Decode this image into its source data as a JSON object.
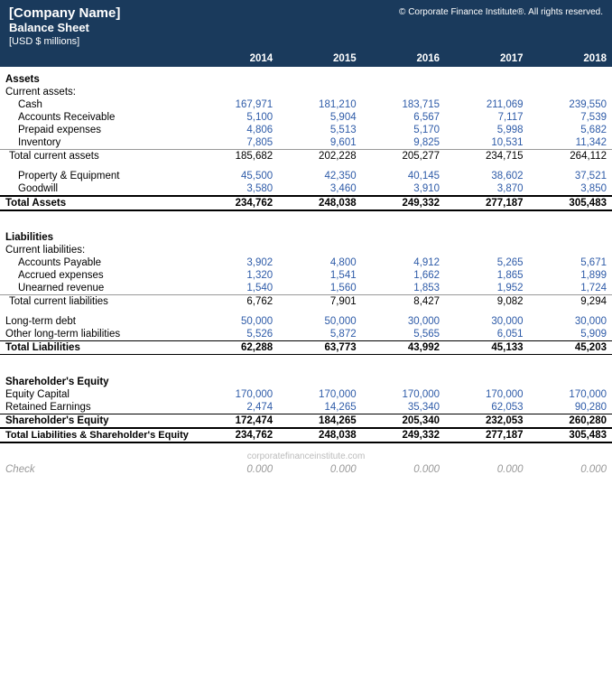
{
  "header": {
    "company_name": "[Company Name]",
    "sheet_title": "Balance Sheet",
    "currency": "[USD $ millions]",
    "copyright": "© Corporate Finance Institute®. All rights reserved."
  },
  "years": [
    "",
    "2014",
    "2015",
    "2016",
    "2017",
    "2018"
  ],
  "sections": {
    "assets_header": "Assets",
    "current_assets_header": "Current assets:",
    "liabilities_header": "Liabilities",
    "current_liabilities_header": "Current liabilities:",
    "shareholder_equity_header": "Shareholder's Equity"
  },
  "rows": {
    "cash": {
      "label": "Cash",
      "values": [
        "167,971",
        "181,210",
        "183,715",
        "211,069",
        "239,550"
      ]
    },
    "accounts_receivable": {
      "label": "Accounts Receivable",
      "values": [
        "5,100",
        "5,904",
        "6,567",
        "7,117",
        "7,539"
      ]
    },
    "prepaid_expenses": {
      "label": "Prepaid expenses",
      "values": [
        "4,806",
        "5,513",
        "5,170",
        "5,998",
        "5,682"
      ]
    },
    "inventory": {
      "label": "Inventory",
      "values": [
        "7,805",
        "9,601",
        "9,825",
        "10,531",
        "11,342"
      ]
    },
    "total_current_assets": {
      "label": "Total current assets",
      "values": [
        "185,682",
        "202,228",
        "205,277",
        "234,715",
        "264,112"
      ]
    },
    "property_equipment": {
      "label": "Property & Equipment",
      "values": [
        "45,500",
        "42,350",
        "40,145",
        "38,602",
        "37,521"
      ]
    },
    "goodwill": {
      "label": "Goodwill",
      "values": [
        "3,580",
        "3,460",
        "3,910",
        "3,870",
        "3,850"
      ]
    },
    "total_assets": {
      "label": "Total Assets",
      "values": [
        "234,762",
        "248,038",
        "249,332",
        "277,187",
        "305,483"
      ]
    },
    "accounts_payable": {
      "label": "Accounts Payable",
      "values": [
        "3,902",
        "4,800",
        "4,912",
        "5,265",
        "5,671"
      ]
    },
    "accrued_expenses": {
      "label": "Accrued expenses",
      "values": [
        "1,320",
        "1,541",
        "1,662",
        "1,865",
        "1,899"
      ]
    },
    "unearned_revenue": {
      "label": "Unearned revenue",
      "values": [
        "1,540",
        "1,560",
        "1,853",
        "1,952",
        "1,724"
      ]
    },
    "total_current_liabilities": {
      "label": "Total current liabilities",
      "values": [
        "6,762",
        "7,901",
        "8,427",
        "9,082",
        "9,294"
      ]
    },
    "long_term_debt": {
      "label": "Long-term debt",
      "values": [
        "50,000",
        "50,000",
        "30,000",
        "30,000",
        "30,000"
      ]
    },
    "other_long_term": {
      "label": "Other long-term liabilities",
      "values": [
        "5,526",
        "5,872",
        "5,565",
        "6,051",
        "5,909"
      ]
    },
    "total_liabilities": {
      "label": "Total Liabilities",
      "values": [
        "62,288",
        "63,773",
        "43,992",
        "45,133",
        "45,203"
      ]
    },
    "equity_capital": {
      "label": "Equity Capital",
      "values": [
        "170,000",
        "170,000",
        "170,000",
        "170,000",
        "170,000"
      ]
    },
    "retained_earnings": {
      "label": "Retained Earnings",
      "values": [
        "2,474",
        "14,265",
        "35,340",
        "62,053",
        "90,280"
      ]
    },
    "shareholder_equity": {
      "label": "Shareholder's Equity",
      "values": [
        "172,474",
        "184,265",
        "205,340",
        "232,053",
        "260,280"
      ]
    },
    "total_liabilities_equity": {
      "label": "Total Liabilities & Shareholder's Equity",
      "values": [
        "234,762",
        "248,038",
        "249,332",
        "277,187",
        "305,483"
      ]
    },
    "check": {
      "label": "Check",
      "values": [
        "0.000",
        "0.000",
        "0.000",
        "0.000",
        "0.000"
      ]
    }
  }
}
